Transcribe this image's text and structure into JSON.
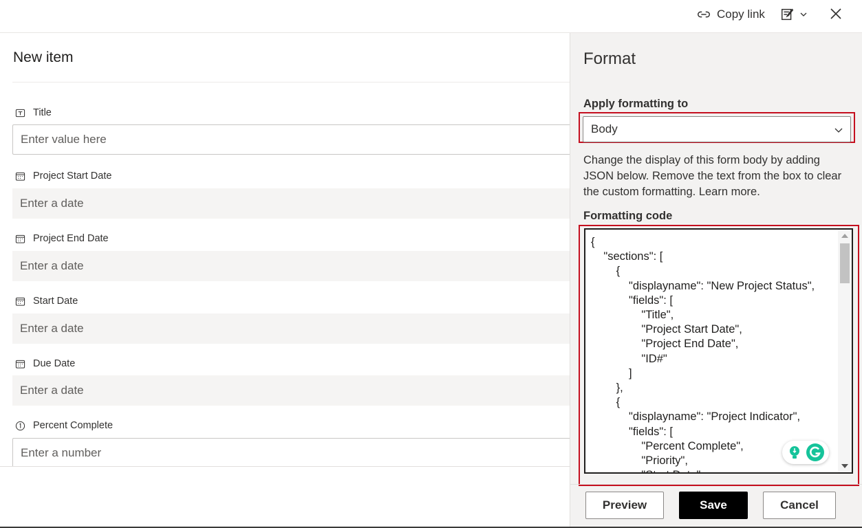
{
  "topbar": {
    "copy_link_label": "Copy link"
  },
  "form": {
    "title": "New item",
    "fields": [
      {
        "label": "Title",
        "placeholder": "Enter value here",
        "icon": "text-field-icon"
      },
      {
        "label": "Project Start Date",
        "placeholder": "Enter a date",
        "icon": "calendar-icon"
      },
      {
        "label": "Project End Date",
        "placeholder": "Enter a date",
        "icon": "calendar-icon"
      },
      {
        "label": "Start Date",
        "placeholder": "Enter a date",
        "icon": "calendar-icon"
      },
      {
        "label": "Due Date",
        "placeholder": "Enter a date",
        "icon": "calendar-icon"
      },
      {
        "label": "Percent Complete",
        "placeholder": "Enter a number",
        "icon": "number-icon"
      }
    ]
  },
  "panel": {
    "title": "Format",
    "apply_label": "Apply formatting to",
    "apply_value": "Body",
    "description": "Change the display of this form body by adding JSON below. Remove the text from the box to clear the custom formatting. Learn more.",
    "code_label": "Formatting code",
    "code": "{\n    \"sections\": [\n        {\n            \"displayname\": \"New Project Status\",\n            \"fields\": [\n                \"Title\",\n                \"Project Start Date\",\n                \"Project End Date\",\n                \"ID#\"\n            ]\n        },\n        {\n            \"displayname\": \"Project Indicator\",\n            \"fields\": [\n                \"Percent Complete\",\n                \"Priority\",\n                \"Start Date\"",
    "buttons": {
      "preview": "Preview",
      "save": "Save",
      "cancel": "Cancel"
    }
  },
  "colors": {
    "highlight": "#c50f1f",
    "grammarly_green": "#15c39a",
    "save_bg": "#000000"
  }
}
